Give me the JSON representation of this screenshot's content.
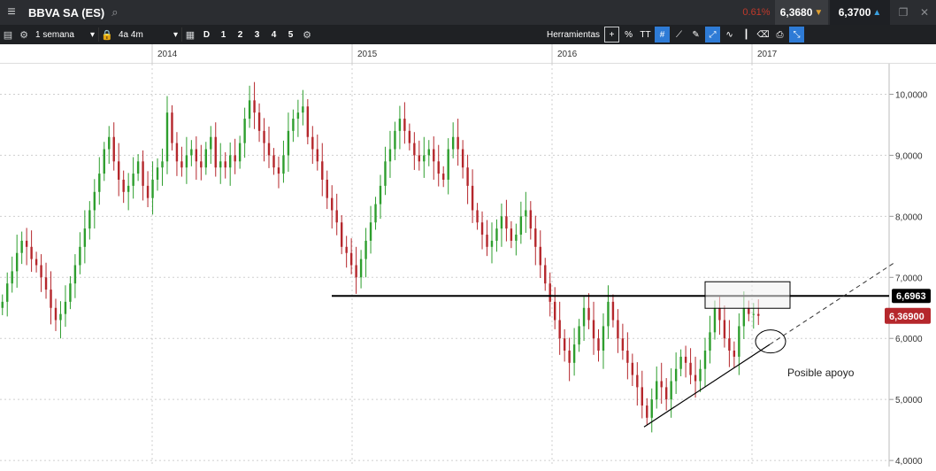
{
  "window": {
    "title": "BBVA SA (ES)",
    "change": "0.61%",
    "bid": "6,3680",
    "ask": "6,3700",
    "icons": {
      "menu": "hamburger-icon",
      "search": "search-icon",
      "popout": "popout-icon",
      "close": "close-icon"
    }
  },
  "toolbar": {
    "interval": "1 semana",
    "range": "4a 4m",
    "d_label": "D",
    "numbers": [
      "1",
      "2",
      "3",
      "4",
      "5"
    ],
    "tools_label": "Herramientas",
    "percent": "%",
    "text_tool": "TT"
  },
  "time_axis": [
    "2014",
    "2015",
    "2016",
    "2017"
  ],
  "price_axis": [
    "10,0000",
    "9,0000",
    "8,0000",
    "7,0000",
    "6,0000",
    "5,0000",
    "4,0000"
  ],
  "price_badges": {
    "resistance": "6,6963",
    "last": "6,36900"
  },
  "annotations": {
    "support": "Posible apoyo"
  },
  "colors": {
    "up": "#2e9e2e",
    "down": "#b5272c",
    "last_badge": "#b5272c",
    "resistance_badge": "#000000",
    "accent": "#2e7bd6"
  },
  "chart_data": {
    "type": "candlestick",
    "interval": "1 semana",
    "ylim": [
      3.9,
      10.5
    ],
    "x_years": [
      "2014",
      "2015",
      "2016",
      "2017"
    ],
    "series": [
      {
        "values": [
          6.6,
          6.9,
          7.1,
          7.4,
          7.6,
          7.5,
          7.3,
          7.2,
          7.0,
          6.8,
          6.5,
          6.3,
          6.4,
          6.6,
          6.9,
          7.2,
          7.5,
          7.8,
          8.1,
          8.4,
          8.7,
          9.1,
          9.3,
          8.9,
          8.6,
          8.4,
          8.5,
          8.7,
          8.9,
          8.5,
          8.3,
          8.6,
          8.8,
          8.9,
          9.7,
          9.2,
          8.9,
          8.8,
          9.0,
          9.1,
          8.9,
          8.8,
          9.1,
          9.3,
          8.8,
          8.9,
          8.8,
          9.0,
          8.9,
          9.2,
          9.6,
          9.9,
          9.7,
          9.4,
          9.2,
          9.0,
          8.8,
          8.7,
          9.0,
          9.4,
          9.6,
          9.7,
          9.8,
          9.3,
          9.1,
          8.9,
          8.6,
          8.3,
          8.1,
          7.9,
          7.5,
          7.4,
          7.2,
          7.0,
          7.3,
          7.6,
          7.9,
          8.2,
          8.5,
          8.9,
          9.1,
          9.4,
          9.6,
          9.4,
          9.2,
          9.0,
          8.9,
          9.0,
          9.1,
          8.9,
          8.7,
          8.6,
          9.1,
          9.3,
          9.1,
          8.8,
          8.5,
          8.1,
          7.9,
          7.7,
          7.5,
          7.6,
          7.8,
          8.0,
          7.8,
          7.6,
          7.7,
          8.0,
          8.1,
          7.8,
          7.5,
          7.2,
          6.9,
          6.6,
          6.3,
          6.0,
          5.8,
          5.6,
          5.9,
          6.2,
          6.5,
          6.3,
          6.0,
          5.8,
          6.2,
          6.6,
          6.3,
          6.0,
          5.8,
          5.6,
          5.4,
          5.2,
          4.9,
          4.7,
          5.0,
          5.3,
          5.2,
          5.0,
          5.3,
          5.5,
          5.7,
          5.6,
          5.4,
          5.3,
          5.5,
          5.8,
          6.1,
          6.5,
          6.3,
          6.0,
          5.8,
          5.7,
          6.2,
          6.5,
          6.4,
          6.4,
          6.37
        ]
      }
    ],
    "annotations": {
      "resistance": 6.6963,
      "last": 6.369,
      "support_label": "Posible apoyo"
    }
  }
}
